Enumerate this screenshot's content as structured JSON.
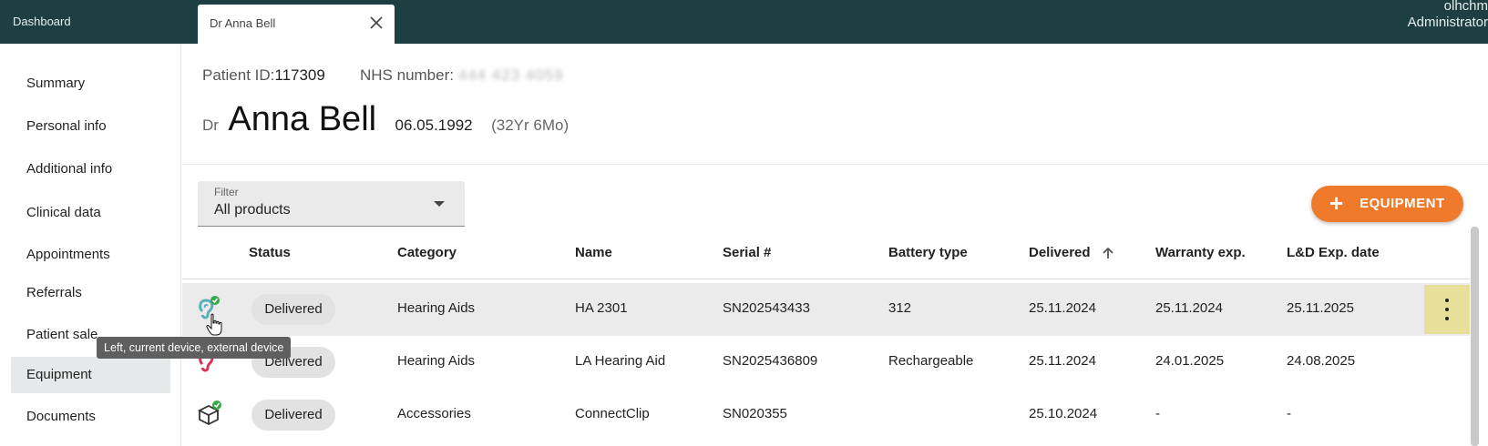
{
  "topbar": {
    "dashboard_label": "Dashboard",
    "tab_label": "Dr Anna Bell",
    "user_name": "olhchm",
    "user_role": "Administrator",
    "background_color": "#1d3f42"
  },
  "sidebar": {
    "items": [
      {
        "label": "Summary"
      },
      {
        "label": "Personal info"
      },
      {
        "label": "Additional info"
      },
      {
        "label": "Clinical data"
      },
      {
        "label": "Appointments"
      },
      {
        "label": "Referrals"
      },
      {
        "label": "Patient sale"
      },
      {
        "label": "Equipment",
        "active": true
      },
      {
        "label": "Documents"
      }
    ]
  },
  "patient": {
    "id_label": "Patient ID:",
    "id_value": "117309",
    "nhs_label": "NHS number:",
    "nhs_value": "444 423 4059",
    "title": "Dr",
    "name": "Anna Bell",
    "dob": "06.05.1992",
    "age": "(32Yr 6Mo)"
  },
  "filter": {
    "label": "Filter",
    "value": "All products"
  },
  "add_button": {
    "icon": "plus-icon",
    "label": "EQUIPMENT",
    "color": "#f07a2c"
  },
  "table": {
    "columns": {
      "status": "Status",
      "category": "Category",
      "name": "Name",
      "serial": "Serial #",
      "battery": "Battery type",
      "delivered": "Delivered",
      "warranty": "Warranty exp.",
      "ld_exp": "L&D Exp. date"
    },
    "sort": {
      "column": "delivered",
      "direction": "ascending",
      "icon": "arrow-up-icon"
    },
    "rows": [
      {
        "icon": "ear-icon-left-current",
        "status": "Delivered",
        "category": "Hearing Aids",
        "name": "HA 2301",
        "serial": "SN202543433",
        "battery": "312",
        "delivered": "25.11.2024",
        "warranty": "25.11.2024",
        "ld_exp": "25.11.2025"
      },
      {
        "icon": "ear-icon-red",
        "status": "Delivered",
        "category": "Hearing Aids",
        "name": "LA Hearing Aid",
        "serial": "SN2025436809",
        "battery": "Rechargeable",
        "delivered": "25.11.2024",
        "warranty": "24.01.2025",
        "ld_exp": "24.08.2025"
      },
      {
        "icon": "box-icon",
        "status": "Delivered",
        "category": "Accessories",
        "name": "ConnectClip",
        "serial": "SN020355",
        "battery": "",
        "delivered": "25.10.2024",
        "warranty": "-",
        "ld_exp": "-"
      }
    ]
  },
  "tooltip": {
    "text": "Left, current device, external device"
  }
}
